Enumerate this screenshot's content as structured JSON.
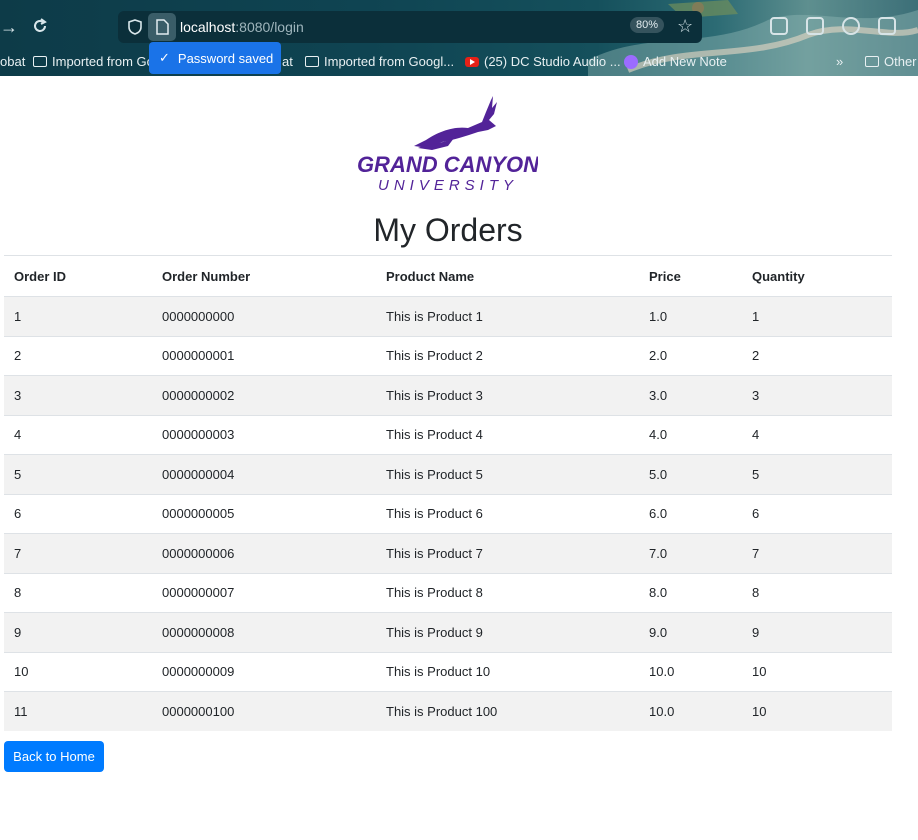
{
  "browser": {
    "url_host": "localhost",
    "url_rest": ":8080/login",
    "zoom": "80%",
    "bookmarks": [
      {
        "label": "obat",
        "icon": "none"
      },
      {
        "label": "Imported from Go",
        "icon": "folder-icon"
      },
      {
        "label": "at",
        "icon": "none"
      },
      {
        "label": "Imported from Googl...",
        "icon": "folder-icon"
      },
      {
        "label": "(25) DC Studio Audio ...",
        "icon": "youtube-icon"
      },
      {
        "label": "Add New Note",
        "icon": "note-icon"
      },
      {
        "label": "Other",
        "icon": "folder-icon"
      }
    ],
    "password_toast": "Password saved"
  },
  "logo": {
    "line1": "GRAND CANYON",
    "line2": "UNIVERSITY",
    "color": "#522398"
  },
  "page": {
    "title": "My Orders",
    "back_button": "Back to Home"
  },
  "table": {
    "headers": [
      "Order ID",
      "Order Number",
      "Product Name",
      "Price",
      "Quantity"
    ],
    "rows": [
      [
        "1",
        "0000000000",
        "This is Product 1",
        "1.0",
        "1"
      ],
      [
        "2",
        "0000000001",
        "This is Product 2",
        "2.0",
        "2"
      ],
      [
        "3",
        "0000000002",
        "This is Product 3",
        "3.0",
        "3"
      ],
      [
        "4",
        "0000000003",
        "This is Product 4",
        "4.0",
        "4"
      ],
      [
        "5",
        "0000000004",
        "This is Product 5",
        "5.0",
        "5"
      ],
      [
        "6",
        "0000000005",
        "This is Product 6",
        "6.0",
        "6"
      ],
      [
        "7",
        "0000000006",
        "This is Product 7",
        "7.0",
        "7"
      ],
      [
        "8",
        "0000000007",
        "This is Product 8",
        "8.0",
        "8"
      ],
      [
        "9",
        "0000000008",
        "This is Product 9",
        "9.0",
        "9"
      ],
      [
        "10",
        "0000000009",
        "This is Product 10",
        "10.0",
        "10"
      ],
      [
        "11",
        "0000000100",
        "This is Product 100",
        "10.0",
        "10"
      ]
    ]
  },
  "colors": {
    "primary_button": "#007bff",
    "toast": "#1a73e8",
    "stripe": "#f2f2f2"
  }
}
